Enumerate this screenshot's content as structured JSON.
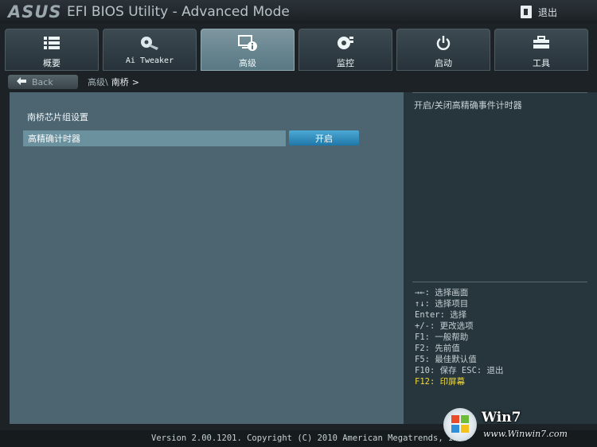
{
  "brand": "ASUS",
  "window_title": "EFI BIOS Utility - Advanced Mode",
  "exit_label": "退出",
  "tabs": [
    {
      "label": "概要",
      "icon": "list-icon"
    },
    {
      "label": "Ai Tweaker",
      "icon": "fan-icon"
    },
    {
      "label": "高级",
      "icon": "advanced-info-icon",
      "active": true
    },
    {
      "label": "监控",
      "icon": "monitor-gauge-icon"
    },
    {
      "label": "启动",
      "icon": "power-icon"
    },
    {
      "label": "工具",
      "icon": "toolbox-icon"
    }
  ],
  "back_label": "Back",
  "breadcrumbs": [
    "高级\\",
    "南桥",
    ">"
  ],
  "section_title": "南桥芯片组设置",
  "setting": {
    "label": "高精确计时器",
    "value": "开启"
  },
  "help_text": "开启/关闭高精确事件计时器",
  "key_help": [
    "→←: 选择画面",
    "↑↓: 选择项目",
    "Enter: 选择",
    "+/-: 更改选项",
    "F1: 一般帮助",
    "F2: 先前值",
    "F5: 最佳默认值",
    "F10: 保存  ESC: 退出",
    "F12: 印屏幕"
  ],
  "footer": "Version 2.00.1201. Copyright (C) 2010 American Megatrends, Inc.",
  "watermark": {
    "brand": "Win7",
    "url": "www.Winwin7.com"
  },
  "colors": {
    "active_tab": "#6d8a94",
    "value_button": "#2f8fc0",
    "highlight_row": "#6c919e",
    "hotkey_highlight": "#f2da3a"
  }
}
